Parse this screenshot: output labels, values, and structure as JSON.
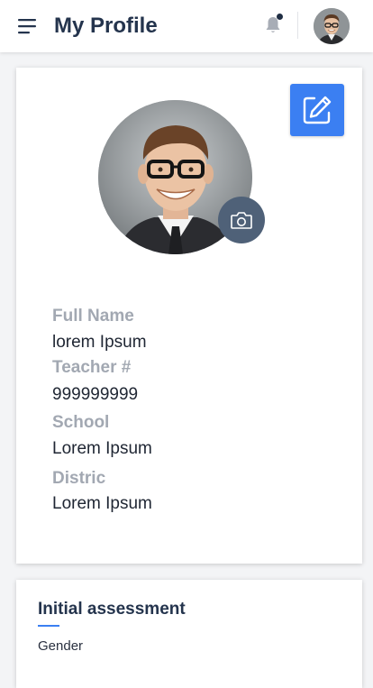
{
  "header": {
    "title": "My Profile",
    "menu_icon": "hamburger-menu-icon",
    "bell_icon": "bell-icon",
    "avatar": "user-avatar"
  },
  "profile": {
    "edit_icon": "pencil-square-icon",
    "camera_icon": "camera-icon",
    "fields": [
      {
        "label": "Full Name",
        "value": "lorem Ipsum"
      },
      {
        "label": "Teacher #",
        "value": "999999999"
      },
      {
        "label": "School",
        "value": "Lorem Ipsum"
      },
      {
        "label": "Distric",
        "value": "Lorem Ipsum"
      }
    ]
  },
  "assessment": {
    "title": "Initial assessment",
    "gender_label": "Gender"
  },
  "colors": {
    "primary": "#3b7ff2",
    "title": "#24344d",
    "label": "#a2a8b2",
    "camera_bg": "#4f6178"
  }
}
